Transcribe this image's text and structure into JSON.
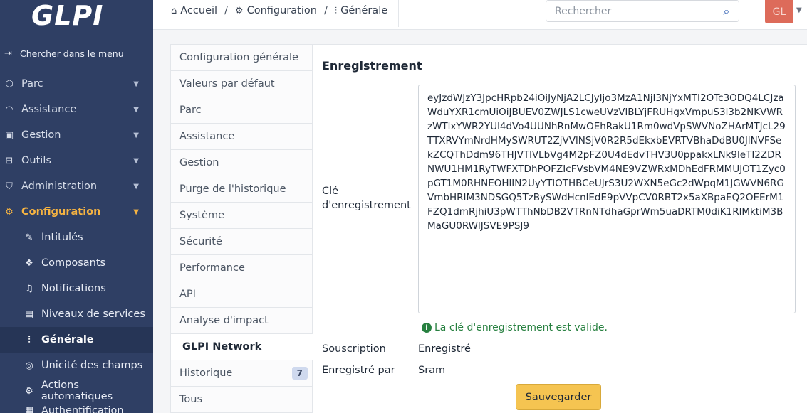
{
  "logo": "GLPI",
  "sidebar": {
    "search_label": "Chercher dans le menu",
    "items": [
      {
        "label": "Parc",
        "icon": "box-icon"
      },
      {
        "label": "Assistance",
        "icon": "headset-icon"
      },
      {
        "label": "Gestion",
        "icon": "wallet-icon"
      },
      {
        "label": "Outils",
        "icon": "briefcase-icon"
      },
      {
        "label": "Administration",
        "icon": "shield-icon"
      },
      {
        "label": "Configuration",
        "icon": "gear-icon",
        "active": true
      }
    ],
    "subitems": [
      {
        "label": "Intitulés",
        "icon": "edit-icon"
      },
      {
        "label": "Composants",
        "icon": "components-icon"
      },
      {
        "label": "Notifications",
        "icon": "bell-icon"
      },
      {
        "label": "Niveaux de services",
        "icon": "clipboard-icon"
      },
      {
        "label": "Générale",
        "icon": "sliders-icon",
        "current": true
      },
      {
        "label": "Unicité des champs",
        "icon": "fingerprint-icon"
      },
      {
        "label": "Actions automatiques",
        "icon": "cog-icon"
      },
      {
        "label": "Authentification",
        "icon": "id-icon"
      }
    ]
  },
  "breadcrumb": {
    "home": "Accueil",
    "configuration": "Configuration",
    "current": "Générale"
  },
  "search": {
    "placeholder": "Rechercher"
  },
  "user": {
    "initials": "GL"
  },
  "tabs": [
    {
      "label": "Configuration générale"
    },
    {
      "label": "Valeurs par défaut"
    },
    {
      "label": "Parc"
    },
    {
      "label": "Assistance"
    },
    {
      "label": "Gestion"
    },
    {
      "label": "Purge de l'historique"
    },
    {
      "label": "Système"
    },
    {
      "label": "Sécurité"
    },
    {
      "label": "Performance"
    },
    {
      "label": "API"
    },
    {
      "label": "Analyse d'impact"
    },
    {
      "label": "GLPI Network",
      "active": true
    },
    {
      "label": "Historique",
      "badge": "7"
    },
    {
      "label": "Tous"
    }
  ],
  "panel": {
    "title": "Enregistrement",
    "key_label": "Clé d'enregistrement",
    "key_value": "eyJzdWJzY3JpcHRpb24iOiJyNjA2LCJyljo3MzA1NjI3NjYxMTI2OTc3ODQ4LCJzaWduYXR1cmUiOiJBUEV0ZWJLS1cweUVzVlBLYjFRUHgxVmpuS3l3b2NKVWRzWTlxYWR2YUl4dVo4UUNhRnMwOEhRakU1Rm0wdVpSWVNoZHArMTJcL29TTXRVYmNrdHMySWRUT2ZjVVlNSjV0R2R5dEkxbEVRTVBhaDdBU0JlNVFSekZCQThDdm96THJVTlVLbVg4M2pFZ0U4dEdvTHV3U0ppakxLNk9leTI2ZDRNWU1HM1RyTWFXTDhPOFZIcFVsbVM4NE9VZWRxMDhEdFRMMUJOT1Zyc0pGT1M0RHNEOHlIN2UyYTlOTHBCeUJrS3U2WXN5eGc2dWpqM1JGWVN6RGVmbHRIM3NDSGQ5TzBySWdHcnlEdE9pVVpCV0RBT2x5aXBpaEQ2OEErM1FZQ1dmRjhiU3pWTThNbDB2VTRnNTdhaGprWm5uaDRTM0diK1RlMktiM3BMaGU0RWlJSVE9PSJ9",
    "valid_message": "La clé d'enregistrement est valide.",
    "subscription_label": "Souscription",
    "subscription_value": "Enregistré",
    "registered_by_label": "Enregistré par",
    "registered_by_value": "Sram",
    "save_label": "Sauvegarder"
  }
}
